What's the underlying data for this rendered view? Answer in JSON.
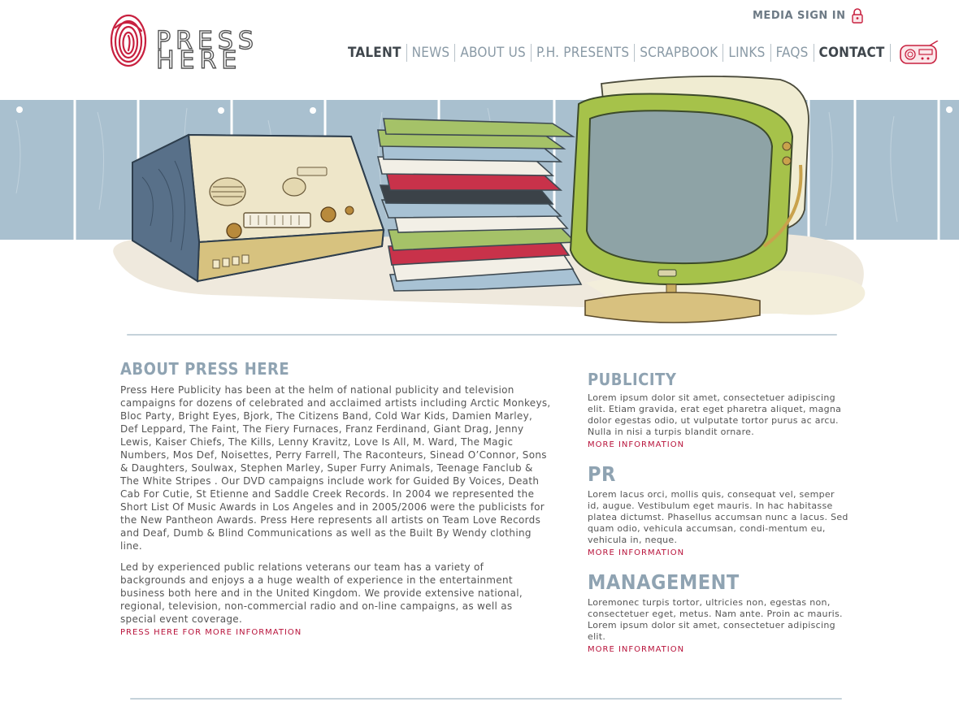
{
  "brand": {
    "logo_line1": "PRESS",
    "logo_line2": "HERE",
    "accent_color": "#c8203f"
  },
  "header": {
    "media_signin": "MEDIA SIGN IN",
    "nav": [
      {
        "label": "TALENT"
      },
      {
        "label": "NEWS"
      },
      {
        "label": "ABOUT US"
      },
      {
        "label": "P.H. PRESENTS"
      },
      {
        "label": "SCRAPBOOK"
      },
      {
        "label": "LINKS"
      },
      {
        "label": "FAQs"
      },
      {
        "label": "CONTACT"
      }
    ]
  },
  "about": {
    "title": "ABOUT PRESS HERE",
    "paragraph1": "Press Here Publicity has been at the helm of national publicity and television campaigns for dozens of celebrated and acclaimed artists including Arctic Monkeys, Bloc Party, Bright Eyes, Bjork, The Citizens Band, Cold War Kids, Damien Marley, Def Leppard, The Faint, The Fiery Furnaces, Franz Ferdinand, Giant Drag, Jenny Lewis, Kaiser Chiefs, The Kills, Lenny Kravitz, Love Is All, M. Ward, The Magic Numbers, Mos Def, Noisettes, Perry Farrell, The Raconteurs, Sinead O’Connor, Sons & Daughters, Soulwax, Stephen Marley, Super Furry Animals, Teenage Fanclub & The White Stripes . Our DVD campaigns include work for Guided By Voices, Death Cab For Cutie, St Etienne and Saddle Creek Records. In 2004 we represented the Short List Of Music Awards in Los Angeles and in 2005/2006 were the publicists for the New Pantheon Awards. Press Here represents all artists on Team Love Records and Deaf, Dumb & Blind Communications as well as the Built By Wendy clothing line.",
    "paragraph2": "Led by experienced public relations veterans our team has a variety of backgrounds and enjoys a a huge wealth of experience in the entertainment business both here and in the United Kingdom. We provide extensive national, regional, television, non-commercial radio and on-line campaigns, as well as special event coverage.",
    "link": "PRESS HERE FOR MORE INFORMATION"
  },
  "services": [
    {
      "title": "PUBLICITY",
      "text": "Lorem ipsum dolor sit amet, consectetuer adipiscing elit. Etiam gravida, erat eget pharetra aliquet, magna dolor egestas odio, ut vulputate tortor purus ac arcu. Nulla in nisi a turpis blandit ornare.",
      "link": "MORE INFORMATION"
    },
    {
      "title": "PR",
      "text": "Lorem lacus orci, mollis quis, consequat vel, semper id, augue. Vestibulum eget mauris. In hac habitasse platea dictumst. Phasellus accumsan nunc a lacus. Sed quam odio, vehicula accumsan, condi-mentum eu, vehicula in, neque.",
      "link": "MORE INFORMATION"
    },
    {
      "title": "MANAGEMENT",
      "text": "Loremonec turpis tortor, ultricies non, egestas non, consectetuer eget, metus. Nam ante. Proin ac mauris. Lorem ipsum dolor sit amet, consectetuer adipiscing elit.",
      "link": "MORE INFORMATION"
    }
  ]
}
